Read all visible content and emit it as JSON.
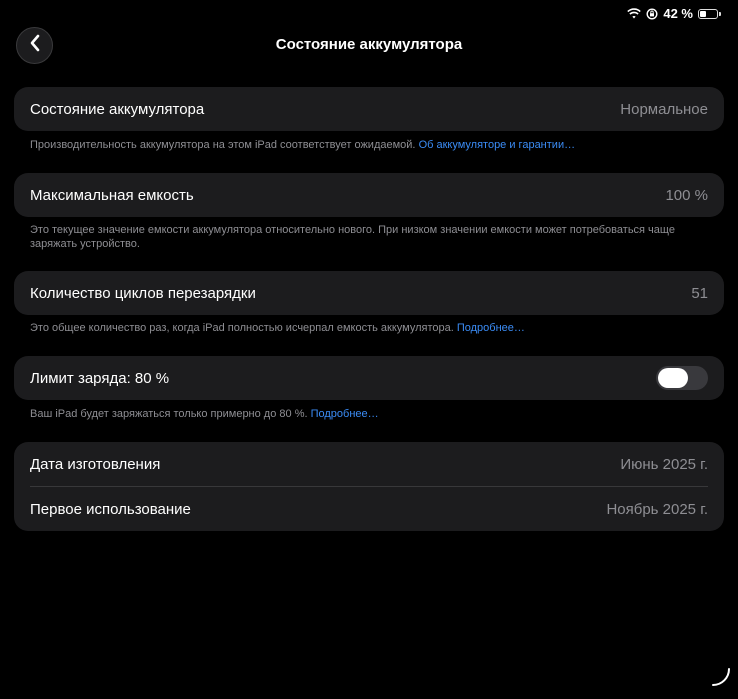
{
  "status_bar": {
    "battery_percent": "42 %",
    "battery_level": 0.42
  },
  "nav": {
    "title": "Состояние аккумулятора"
  },
  "battery_health": {
    "label": "Состояние аккумулятора",
    "value": "Нормальное",
    "footer_text": "Производительность аккумулятора на этом iPad соответствует ожидаемой.",
    "footer_link": "Об аккумуляторе и гарантии…"
  },
  "max_capacity": {
    "label": "Максимальная емкость",
    "value": "100 %",
    "footer_text": "Это текущее значение емкости аккумулятора относительно нового. При низком значении емкости может потребоваться чаще заряжать устройство."
  },
  "cycle_count": {
    "label": "Количество циклов перезарядки",
    "value": "51",
    "footer_text": "Это общее количество раз, когда iPad полностью исчерпал емкость аккумулятора.",
    "footer_link": "Подробнее…"
  },
  "charge_limit": {
    "label": "Лимит заряда: 80 %",
    "toggle_on": false,
    "footer_text": "Ваш iPad будет заряжаться только примерно до 80 %.",
    "footer_link": "Подробнее…"
  },
  "dates": {
    "manufacture_label": "Дата изготовления",
    "manufacture_value": "Июнь 2025 г.",
    "first_use_label": "Первое использование",
    "first_use_value": "Ноябрь 2025 г."
  },
  "colors": {
    "accent_link": "#3b8cf5",
    "cell_background": "#1c1c1e",
    "secondary_text": "#8e8e93"
  }
}
